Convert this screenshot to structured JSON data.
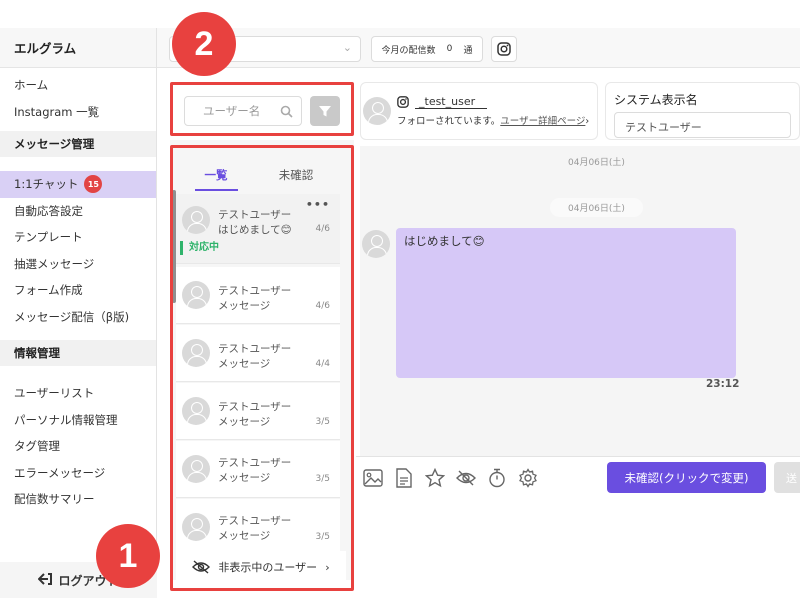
{
  "sidebar": {
    "brand": "エルグラム",
    "items_top": [
      {
        "label": "ホーム"
      },
      {
        "label": "Instagram 一覧"
      }
    ],
    "group_message": "メッセージ管理",
    "chat_item": {
      "label": "1:1チャット",
      "badge": "15"
    },
    "items_message": [
      {
        "label": "自動応答設定"
      },
      {
        "label": "テンプレート"
      },
      {
        "label": "抽選メッセージ"
      },
      {
        "label": "フォーム作成"
      },
      {
        "label": "メッセージ配信（β版)"
      }
    ],
    "group_info": "情報管理",
    "items_info": [
      {
        "label": "ユーザーリスト"
      },
      {
        "label": "パーソナル情報管理"
      },
      {
        "label": "タグ管理"
      },
      {
        "label": "エラーメッセージ"
      },
      {
        "label": "配信数サマリー"
      }
    ],
    "logout": "ログアウト"
  },
  "topbar": {
    "delivery_label": "今月の配信数",
    "delivery_count": "0",
    "delivery_unit": "通"
  },
  "callouts": {
    "box1": "1",
    "box2": "2"
  },
  "search": {
    "placeholder": "ユーザー名"
  },
  "tabs": [
    {
      "label": "一覧"
    },
    {
      "label": "未確認"
    }
  ],
  "conversations": [
    {
      "name": "テストユーザー",
      "message": "はじめまして😊",
      "date": "4/6",
      "status": "対応中"
    },
    {
      "name": "テストユーザー",
      "message": "メッセージ",
      "date": "4/6"
    },
    {
      "name": "テストユーザー",
      "message": "メッセージ",
      "date": "4/4"
    },
    {
      "name": "テストユーザー",
      "message": "メッセージ",
      "date": "3/5"
    },
    {
      "name": "テストユーザー",
      "message": "メッセージ",
      "date": "3/5"
    },
    {
      "name": "テストユーザー",
      "message": "メッセージ",
      "date": "3/5"
    }
  ],
  "hidden_users": "非表示中のユーザー",
  "chat_header": {
    "handle": "_test_user",
    "follow_text": "フォローされています。",
    "detail_link": "ユーザー詳細ページ"
  },
  "system_name": {
    "label": "システム表示名",
    "value": "テストユーザー"
  },
  "chat": {
    "date_top": "04月06日(土)",
    "date_mid": "04月06日(土)",
    "message": "はじめまして😊",
    "time": "23:12"
  },
  "composer": {
    "unread_button": "未確認(クリックで変更)",
    "send_button": "送"
  }
}
